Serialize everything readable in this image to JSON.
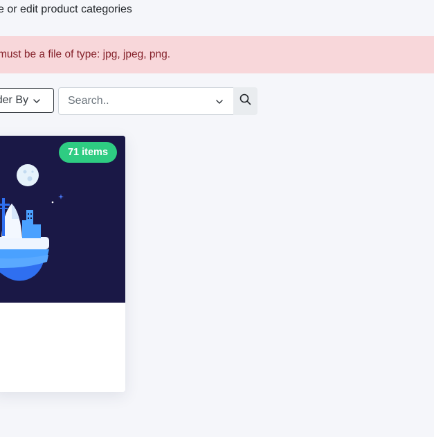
{
  "header": {
    "subtitle": "e or edit product categories"
  },
  "alert": {
    "message": "must be a file of type: jpg, jpeg, png.",
    "color": "#842029",
    "background": "#f8d7da"
  },
  "toolbar": {
    "order_by_label": "der By",
    "order_by_icon": "chevron-down-icon",
    "search_placeholder": "Search..",
    "search_value": "",
    "select_icon": "chevron-down-icon",
    "search_button_icon": "search-icon"
  },
  "categories": [
    {
      "badge": "71 items",
      "badge_color": "#2ecc82",
      "image_background": "#1a1846"
    }
  ]
}
